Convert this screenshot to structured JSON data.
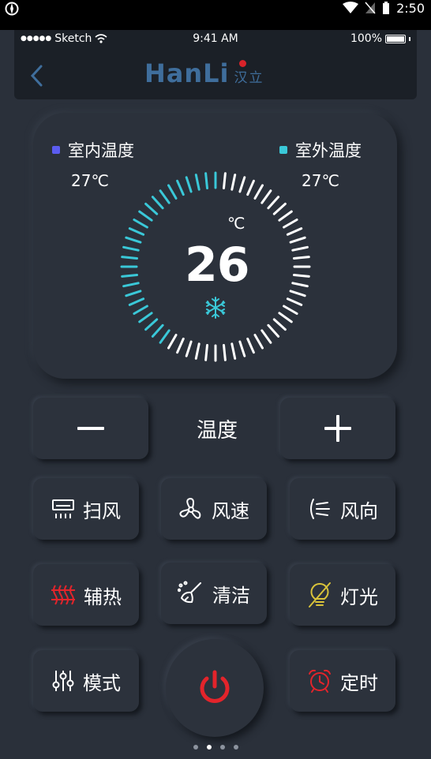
{
  "android_status": {
    "time": "2:50"
  },
  "ios_status": {
    "carrier": "Sketch",
    "time": "9:41 AM",
    "battery": "100%"
  },
  "header": {
    "logo_en": "HanLi",
    "logo_cn": "汉立"
  },
  "temperature_card": {
    "indoor_label": "室内温度",
    "indoor_value": "27℃",
    "indoor_color": "#5b5cf0",
    "outdoor_label": "室外温度",
    "outdoor_value": "27℃",
    "outdoor_color": "#3ac8d8",
    "set_unit": "℃",
    "set_value": "26",
    "mode_icon": "snowflake-icon",
    "dial_accent": "#3ac8d8",
    "dial_level": 0.52
  },
  "controls": {
    "minus_icon": "minus-icon",
    "temp_label": "温度",
    "plus_icon": "plus-icon",
    "swing": "扫风",
    "fan_speed": "风速",
    "direction": "风向",
    "aux_heat": "辅热",
    "clean": "清洁",
    "light": "灯光",
    "mode": "模式",
    "timer": "定时",
    "power_icon": "power-icon",
    "power_color": "#e3242b",
    "highlight_color": "#d8c23a"
  },
  "pager": {
    "pages": 4,
    "active": 1
  }
}
